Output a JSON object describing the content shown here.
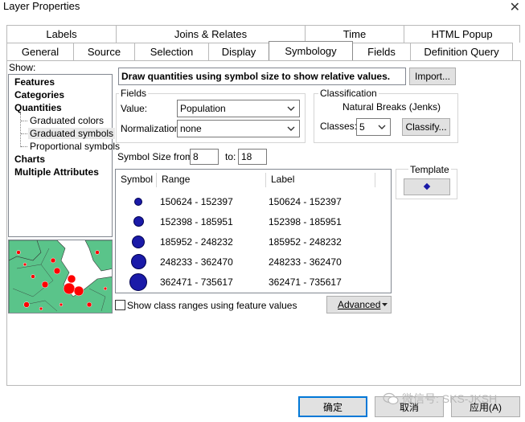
{
  "window": {
    "title": "Layer Properties",
    "close_glyph": "✕"
  },
  "tabs_row1": [
    "Labels",
    "Joins & Relates",
    "Time",
    "HTML Popup"
  ],
  "tabs_row2": [
    "General",
    "Source",
    "Selection",
    "Display",
    "Symbology",
    "Fields",
    "Definition Query"
  ],
  "active_tab": "Symbology",
  "show": {
    "label": "Show:",
    "items": [
      {
        "label": "Features",
        "bold": true
      },
      {
        "label": "Categories",
        "bold": true
      },
      {
        "label": "Quantities",
        "bold": true
      },
      {
        "label": "Graduated colors",
        "bold": false
      },
      {
        "label": "Graduated symbols",
        "bold": false,
        "selected": true
      },
      {
        "label": "Proportional symbols",
        "bold": false
      },
      {
        "label": "Charts",
        "bold": true
      },
      {
        "label": "Multiple Attributes",
        "bold": true
      }
    ]
  },
  "description": "Draw quantities using symbol size to show relative values.",
  "import_label": "Import...",
  "fields": {
    "group_label": "Fields",
    "value_label": "Value:",
    "value": "Population",
    "normalization_label": "Normalization:",
    "normalization": "none"
  },
  "classification": {
    "group_label": "Classification",
    "method": "Natural Breaks (Jenks)",
    "classes_label": "Classes:",
    "classes": "5",
    "classify_label": "Classify..."
  },
  "symbol_size": {
    "from_label": "Symbol Size from:",
    "from": "8",
    "to_label": "to:",
    "to": "18"
  },
  "table": {
    "headers": [
      "Symbol",
      "Range",
      "Label"
    ],
    "rows": [
      {
        "range": "150624 - 152397",
        "label": "150624 - 152397",
        "size": 10
      },
      {
        "range": "152398 - 185951",
        "label": "152398 - 185951",
        "size": 13
      },
      {
        "range": "185952 - 248232",
        "label": "185952 - 248232",
        "size": 16
      },
      {
        "range": "248233 - 362470",
        "label": "248233 - 362470",
        "size": 19
      },
      {
        "range": "362471 - 735617",
        "label": "362471 - 735617",
        "size": 22
      }
    ],
    "symbol_color": "#1a1aa8"
  },
  "template_label": "Template",
  "show_ranges_label": "Show class ranges using feature values",
  "advanced_label": "Advanced",
  "buttons": {
    "ok": "确定",
    "cancel": "取消",
    "apply": "应用(A)"
  },
  "watermark": "微信号: SKS-JKSH",
  "map_colors": {
    "land": "#5ac48a",
    "water": "#ffffff",
    "point": "#ff0000"
  }
}
